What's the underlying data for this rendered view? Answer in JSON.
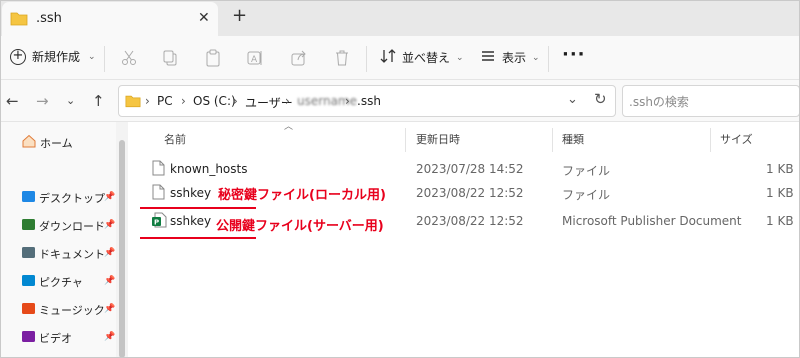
{
  "window": {
    "tab_title": ".ssh",
    "close_glyph": "✕",
    "add_glyph": "+"
  },
  "toolbar": {
    "new_label": "新規作成",
    "sort_label": "並べ替え",
    "view_label": "表示",
    "more_glyph": "···"
  },
  "address": {
    "parts": [
      "PC",
      "OS (C:)",
      "ユーザー",
      ".ssh"
    ],
    "blurred_user": "username",
    "search_placeholder": ".sshの検索"
  },
  "sidebar": {
    "home": "ホーム",
    "items": [
      {
        "label": "デスクトップ",
        "icon": "desktop-icon",
        "color": "#1e88e5"
      },
      {
        "label": "ダウンロード",
        "icon": "download-icon",
        "color": "#2e7d32"
      },
      {
        "label": "ドキュメント",
        "icon": "document-icon",
        "color": "#546e7a"
      },
      {
        "label": "ピクチャ",
        "icon": "picture-icon",
        "color": "#0288d1"
      },
      {
        "label": "ミュージック",
        "icon": "music-icon",
        "color": "#e64a19"
      },
      {
        "label": "ビデオ",
        "icon": "video-icon",
        "color": "#7b1fa2"
      }
    ]
  },
  "columns": {
    "name": "名前",
    "modified": "更新日時",
    "type": "種類",
    "size": "サイズ"
  },
  "files": [
    {
      "name": "known_hosts",
      "modified": "2023/07/28 14:52",
      "type": "ファイル",
      "size": "1 KB"
    },
    {
      "name": "sshkey",
      "modified": "2023/08/22 12:52",
      "type": "ファイル",
      "size": "1 KB"
    },
    {
      "name": "sshkey",
      "modified": "2023/08/22 12:52",
      "type": "Microsoft Publisher Document",
      "size": "1 KB"
    }
  ],
  "annotations": {
    "private_key": "秘密鍵ファイル(ローカル用)",
    "public_key": "公開鍵ファイル(サーバー用)"
  },
  "colors": {
    "annotation": "#e8001c",
    "folder": "#f5c542",
    "publisher": "#107c41"
  }
}
